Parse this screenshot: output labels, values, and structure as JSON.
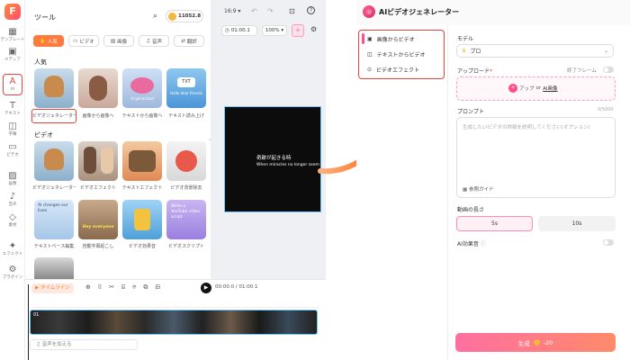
{
  "rail": {
    "items": [
      {
        "icon": "▦",
        "label": "テンプレート"
      },
      {
        "icon": "▣",
        "label": "メディア"
      },
      {
        "icon": "A",
        "label": "AI"
      },
      {
        "icon": "T",
        "label": "テキスト"
      },
      {
        "icon": "◫",
        "label": "字幕"
      },
      {
        "icon": "▭",
        "label": "ビデオ"
      },
      {
        "icon": "▨",
        "label": "画像"
      },
      {
        "icon": "♪",
        "label": "音声"
      },
      {
        "icon": "◇",
        "label": "素材"
      },
      {
        "icon": "✦",
        "label": "エフェクト"
      },
      {
        "icon": "⚙",
        "label": "プラグイン"
      }
    ]
  },
  "tools": {
    "title": "ツール",
    "credits": "11052.8",
    "chips": [
      "人気",
      "ビデオ",
      "画像",
      "音声",
      "翻訳"
    ],
    "sections": {
      "popular": "人気",
      "video": "ビデオ"
    },
    "popular_items": [
      "ビデオジェネレーター",
      "画像から画像へ",
      "テキストから画像へ",
      "テキスト読み上げ"
    ],
    "video_items": [
      "ビデオジェネレーター",
      "ビデオエフェクト",
      "テキストエフェクト",
      "ビデオ背景除去"
    ],
    "more_items": [
      "テキストベース編集",
      "自動字幕起こし",
      "ビデオ効果音",
      "ビデオスクリプト"
    ],
    "thumb_texts": {
      "t2i": "AI generated",
      "tts": "TXT",
      "tts_sub": "Hello dear friends",
      "ai_changes": "AI changes our lives",
      "hey": "Hey everyone",
      "yt": "Write a YouTube video script"
    }
  },
  "editor": {
    "ratio": "16:9",
    "time_current": "01:00.1",
    "zoom": "100%",
    "overlay_jp": "奇跡が起きる時",
    "overlay_en": "When miracles no longer seem",
    "playback_time": "00:00.0 / 01:00.1",
    "timeline_label": "タイムライン",
    "track_label": "01",
    "add_audio": "音声を加える"
  },
  "right": {
    "title": "AIビデオジェネレーター",
    "menu": [
      "画像からビデオ",
      "テキストからビデオ",
      "ビデオエフェクト"
    ],
    "model_label": "モデル",
    "model_value": "プロ",
    "upload_label": "アップロード",
    "required_mark": "*",
    "end_frame_label": "終了フレーム",
    "upload_text": "アップ",
    "upload_or": "or",
    "upload_ai": "AI画像",
    "prompt_label": "プロンプト",
    "prompt_count": "0/5000",
    "prompt_placeholder": "生成したいビデオの詳細を説明してください(オプション)",
    "prompt_guide": "参照ガイド",
    "duration_label": "動画の長さ",
    "duration_options": [
      "5s",
      "10s"
    ],
    "ai_sound_label": "AI効果音",
    "generate_label": "生成",
    "generate_cost": "-20"
  },
  "colors": {
    "accent": "#ff7a3d",
    "pink": "#ff4d8a",
    "highlight_red": "#e0463c"
  }
}
